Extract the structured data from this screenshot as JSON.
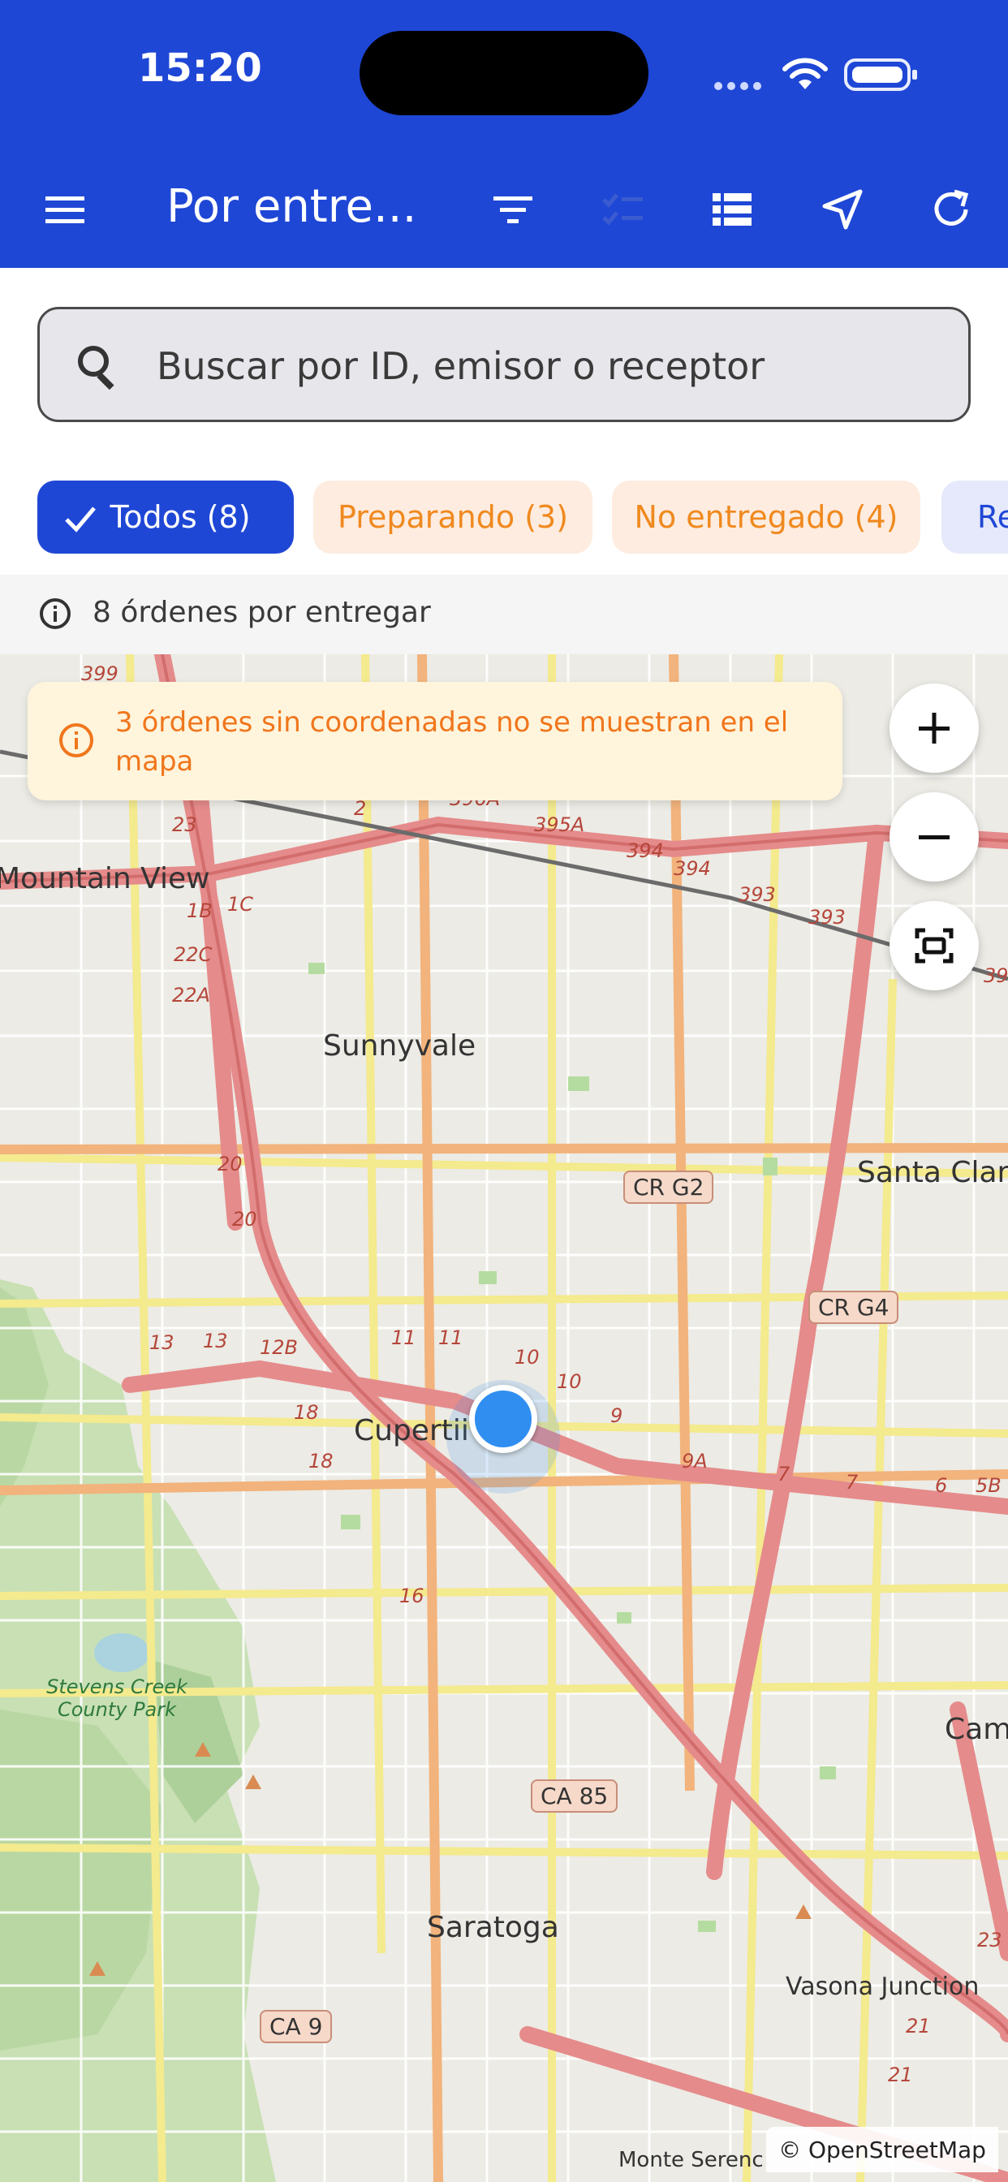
{
  "status_bar": {
    "time": "15:20"
  },
  "toolbar": {
    "title": "Por entre...",
    "icons": [
      "menu-icon",
      "filter-icon",
      "checklist-icon",
      "list-view-icon",
      "navigate-icon",
      "refresh-icon"
    ]
  },
  "search": {
    "placeholder": "Buscar por ID, emisor o receptor",
    "value": ""
  },
  "filters": [
    {
      "label": "Todos (8)",
      "selected": true
    },
    {
      "label": "Preparando (3)",
      "selected": false
    },
    {
      "label": "No entregado (4)",
      "selected": false
    },
    {
      "label": "Re",
      "selected": false
    }
  ],
  "summary": {
    "text": "8 órdenes por entregar"
  },
  "map": {
    "banner": "3 órdenes sin coordenadas no se muestran en el mapa",
    "attribution": "© OpenStreetMap",
    "places": [
      "Mountain View",
      "Sunnyvale",
      "Santa Clar",
      "Cupertii",
      "Stevens Creek County Park",
      "Saratoga",
      "Cam",
      "Vasona Junction",
      "Monte Serenc"
    ],
    "shields": [
      "CR G2",
      "CR G4",
      "CA 85",
      "CA 9",
      "396A",
      "395A"
    ],
    "route_numbers": [
      "399",
      "23",
      "2",
      "1B",
      "1C",
      "22C",
      "22A",
      "394",
      "394",
      "393",
      "393",
      "39",
      "20",
      "20",
      "13",
      "13",
      "12B",
      "11",
      "11",
      "10",
      "10",
      "9",
      "9A",
      "7",
      "7",
      "6",
      "5B",
      "18",
      "18",
      "16",
      "23",
      "21",
      "21"
    ],
    "colors": {
      "accent": "#1f47d6",
      "warning": "#f0761c",
      "location": "#2f8ef0"
    }
  }
}
